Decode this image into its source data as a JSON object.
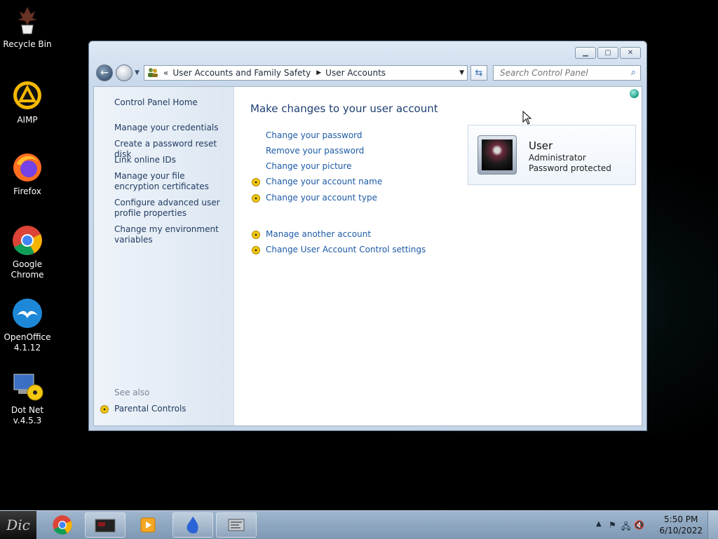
{
  "desktop": {
    "icons": [
      {
        "label": "Recycle Bin"
      },
      {
        "label": "AIMP"
      },
      {
        "label": "Firefox"
      },
      {
        "label": "Google Chrome"
      },
      {
        "label": "OpenOffice 4.1.12"
      },
      {
        "label": "Dot Net v.4.5.3"
      }
    ]
  },
  "window": {
    "breadcrumb": {
      "prefix": "«",
      "items": [
        "User Accounts and Family Safety",
        "User Accounts"
      ]
    },
    "search": {
      "placeholder": "Search Control Panel"
    },
    "left_pane": {
      "home": "Control Panel Home",
      "links": [
        "Manage your credentials",
        "Create a password reset disk",
        "Link online IDs",
        "Manage your file encryption certificates",
        "Configure advanced user profile properties",
        "Change my environment variables"
      ],
      "see_also": "See also",
      "parental_controls": "Parental Controls"
    },
    "main": {
      "heading": "Make changes to your user account",
      "tasks": [
        "Change your password",
        "Remove your password",
        "Change your picture",
        "Change your account name",
        "Change your account type"
      ],
      "other_tasks": [
        "Manage another account",
        "Change User Account Control settings"
      ]
    },
    "user": {
      "name": "User",
      "role": "Administrator",
      "status": "Password protected"
    }
  },
  "taskbar": {
    "start_label": "Dic",
    "clock_time": "5:50 PM",
    "clock_date": "6/10/2022"
  },
  "colors": {
    "link": "#1c5aa6",
    "heading": "#1e3f73",
    "taskbar": "#8fa8c2"
  }
}
